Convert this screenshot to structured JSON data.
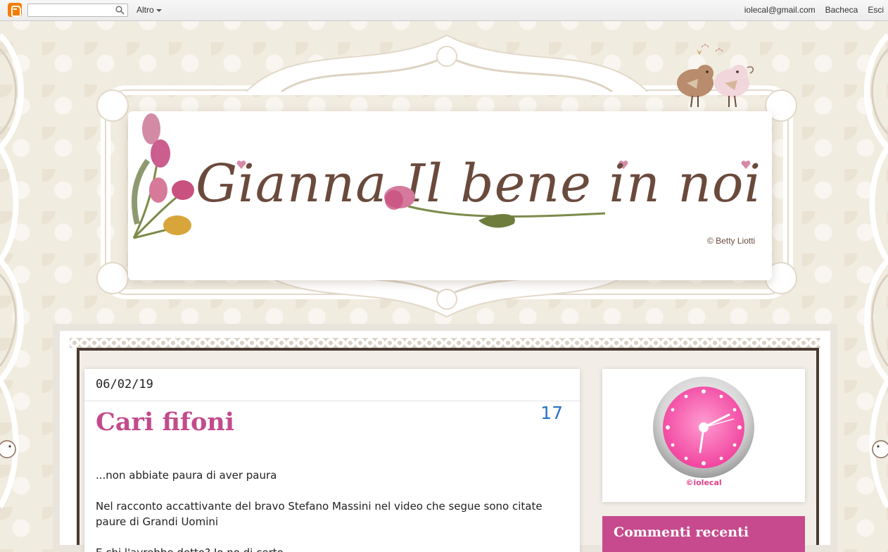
{
  "navbar": {
    "search_placeholder": "",
    "more_label": "Altro",
    "email": "iolecal@gmail.com",
    "dashboard_label": "Bacheca",
    "signout_label": "Esci"
  },
  "header": {
    "title": "Gianna  Il bene in noi",
    "copyright": "© Betty Liotti"
  },
  "post": {
    "date": "06/02/19",
    "title": "Cari fifoni",
    "comment_count": "17",
    "paragraphs": [
      "...non abbiate paura di aver paura",
      "Nel racconto accattivante del bravo Stefano Massini nel video che segue sono citate paure di Grandi Uomini",
      "E chi l'avrebbe detto? Io no di certo"
    ]
  },
  "sidebar": {
    "clock_caption": "©iolecal",
    "recent_comments_title": "Commenti recenti"
  },
  "colors": {
    "accent_pink": "#c24b8c",
    "widget_header": "#c64a8d",
    "link_blue": "#2a72c9",
    "title_brown": "#6a4a3c"
  }
}
